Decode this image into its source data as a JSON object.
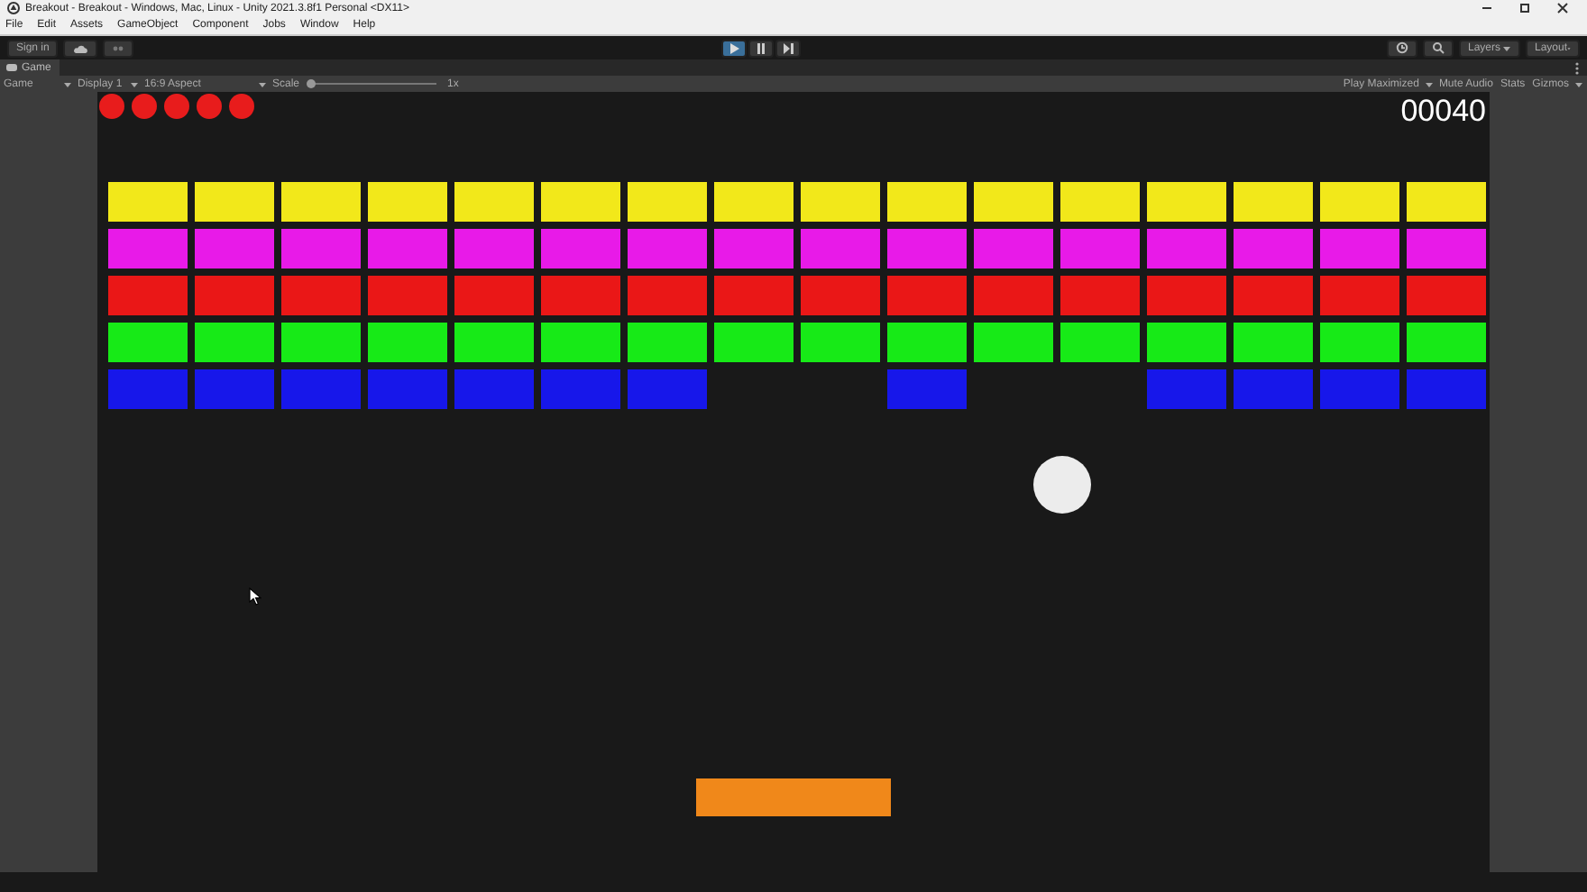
{
  "window": {
    "title": "Breakout - Breakout - Windows, Mac, Linux - Unity 2021.3.8f1 Personal <DX11>"
  },
  "menu": [
    "File",
    "Edit",
    "Assets",
    "GameObject",
    "Component",
    "Jobs",
    "Window",
    "Help"
  ],
  "toolbar": {
    "sign_in": "Sign in",
    "play_controls": [
      {
        "kind": "play",
        "selected": true
      },
      {
        "kind": "pause",
        "selected": false
      },
      {
        "kind": "step",
        "selected": false
      }
    ],
    "layers": "Layers",
    "layout": "Layout"
  },
  "tab": {
    "label": "Game"
  },
  "game_bar": {
    "view": "Game",
    "display": "Display 1",
    "aspect": "16:9 Aspect",
    "scale_label": "Scale",
    "scale": {
      "level": 0.0
    },
    "scale_value": "1x",
    "play_mode": "Play Maximized",
    "toggles": [
      "Mute Audio",
      "Stats",
      "Gizmos"
    ]
  },
  "game": {
    "lives": [
      {
        "lost": false
      },
      {
        "lost": false
      },
      {
        "lost": false
      },
      {
        "lost": false
      },
      {
        "lost": false
      }
    ],
    "score": "00040",
    "brick_rows": [
      {
        "color": "#f2e81a",
        "bricks": [
          {
            "broken": false
          },
          {
            "broken": false
          },
          {
            "broken": false
          },
          {
            "broken": false
          },
          {
            "broken": false
          },
          {
            "broken": false
          },
          {
            "broken": false
          },
          {
            "broken": false
          },
          {
            "broken": false
          },
          {
            "broken": false
          },
          {
            "broken": false
          },
          {
            "broken": false
          },
          {
            "broken": false
          },
          {
            "broken": false
          },
          {
            "broken": false
          },
          {
            "broken": false
          }
        ]
      },
      {
        "color": "#e81ae8",
        "bricks": [
          {
            "broken": false
          },
          {
            "broken": false
          },
          {
            "broken": false
          },
          {
            "broken": false
          },
          {
            "broken": false
          },
          {
            "broken": false
          },
          {
            "broken": false
          },
          {
            "broken": false
          },
          {
            "broken": false
          },
          {
            "broken": false
          },
          {
            "broken": false
          },
          {
            "broken": false
          },
          {
            "broken": false
          },
          {
            "broken": false
          },
          {
            "broken": false
          },
          {
            "broken": false
          }
        ]
      },
      {
        "color": "#ea1717",
        "bricks": [
          {
            "broken": false
          },
          {
            "broken": false
          },
          {
            "broken": false
          },
          {
            "broken": false
          },
          {
            "broken": false
          },
          {
            "broken": false
          },
          {
            "broken": false
          },
          {
            "broken": false
          },
          {
            "broken": false
          },
          {
            "broken": false
          },
          {
            "broken": false
          },
          {
            "broken": false
          },
          {
            "broken": false
          },
          {
            "broken": false
          },
          {
            "broken": false
          },
          {
            "broken": false
          }
        ]
      },
      {
        "color": "#17ea17",
        "bricks": [
          {
            "broken": false
          },
          {
            "broken": false
          },
          {
            "broken": false
          },
          {
            "broken": false
          },
          {
            "broken": false
          },
          {
            "broken": false
          },
          {
            "broken": false
          },
          {
            "broken": false
          },
          {
            "broken": false
          },
          {
            "broken": false
          },
          {
            "broken": false
          },
          {
            "broken": false
          },
          {
            "broken": false
          },
          {
            "broken": false
          },
          {
            "broken": false
          },
          {
            "broken": false
          }
        ]
      },
      {
        "color": "#1717ea",
        "bricks": [
          {
            "broken": false
          },
          {
            "broken": false
          },
          {
            "broken": false
          },
          {
            "broken": false
          },
          {
            "broken": false
          },
          {
            "broken": false
          },
          {
            "broken": false
          },
          {
            "broken": true
          },
          {
            "broken": true
          },
          {
            "broken": false
          },
          {
            "broken": true
          },
          {
            "broken": true
          },
          {
            "broken": false
          },
          {
            "broken": false
          },
          {
            "broken": false
          },
          {
            "broken": false
          }
        ]
      }
    ]
  }
}
